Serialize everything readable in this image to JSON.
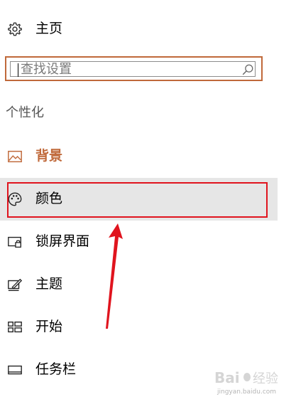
{
  "home": {
    "label": "主页",
    "icon": "gear-icon"
  },
  "search": {
    "placeholder": "查找设置",
    "icon": "search-icon"
  },
  "section_title": "个性化",
  "nav": [
    {
      "label": "背景",
      "icon": "picture-icon",
      "state": "active"
    },
    {
      "label": "颜色",
      "icon": "palette-icon",
      "state": "hover"
    },
    {
      "label": "锁屏界面",
      "icon": "lock-screen-icon",
      "state": "normal"
    },
    {
      "label": "主题",
      "icon": "theme-icon",
      "state": "normal"
    },
    {
      "label": "开始",
      "icon": "start-icon",
      "state": "normal"
    },
    {
      "label": "任务栏",
      "icon": "taskbar-icon",
      "state": "normal"
    }
  ],
  "annotation": {
    "box_color": "#e0141e",
    "arrow_color": "#e0141e"
  },
  "watermark": {
    "text": "jingyan.baidu.com"
  },
  "colors": {
    "accent": "#c0693a",
    "hover_bg": "#e6e6e6"
  }
}
